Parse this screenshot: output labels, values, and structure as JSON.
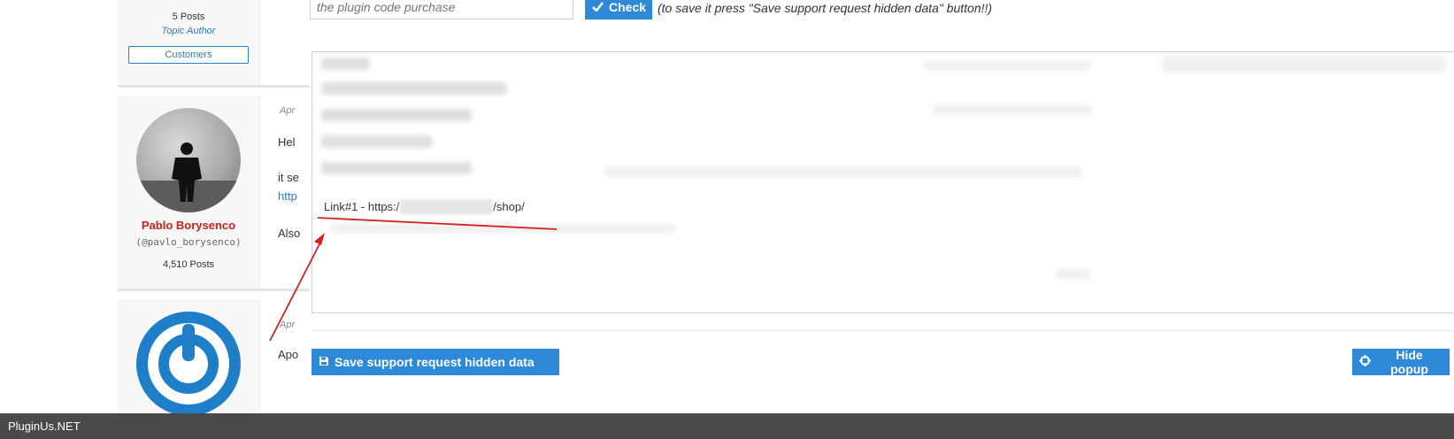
{
  "forum": {
    "author1": {
      "posts": "5 Posts",
      "role": "Topic Author",
      "badge": "Customers"
    },
    "author2": {
      "name": "Pablo Borysenco",
      "handle": "(@pavlo_borysenco)",
      "posts": "4,510 Posts"
    },
    "post1": {
      "date": "Apr",
      "line1": "Hel",
      "line2": "it se",
      "link": "http",
      "line3": "Also"
    },
    "post2": {
      "date": "Apr",
      "line1": "Apo"
    }
  },
  "popup": {
    "code_input_placeholder": "the plugin code purchase",
    "check_button": "Check",
    "check_note": "(to save it press \"Save support request hidden data\" button!!)",
    "link_prefix": "Link#1 - https:/",
    "link_suffix": "/shop/",
    "save_button": "Save support request hidden data",
    "hide_button": "Hide popup"
  },
  "footer": {
    "brand": "PluginUs.NET"
  },
  "colors": {
    "accent": "#2e8ad8",
    "author_name": "#c8201e",
    "footer_bg": "#4a4a4a",
    "annotation": "#d42020"
  },
  "icons": {
    "check": "check-icon",
    "save": "floppy-disk-icon",
    "hide": "crosshair-icon"
  }
}
